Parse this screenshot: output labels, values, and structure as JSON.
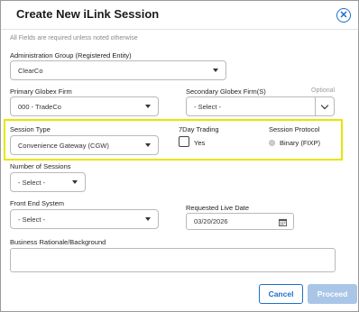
{
  "dialog": {
    "title": "Create New iLink Session",
    "required_note": "All Fields are required unless noted otherwise"
  },
  "fields": {
    "admin_group": {
      "label": "Administration Group (Registered Entity)",
      "value": "ClearCo"
    },
    "primary_firm": {
      "label": "Primary Globex Firm",
      "value": "000 - TradeCo"
    },
    "secondary_firm": {
      "label": "Secondary Globex Firm(S)",
      "optional": "Optional",
      "value": "- Select -"
    },
    "session_type": {
      "label": "Session Type",
      "value": "Convenience Gateway (CGW)"
    },
    "seven_day": {
      "label": "7Day Trading",
      "option": "Yes",
      "checked": false
    },
    "session_protocol": {
      "label": "Session Protocol",
      "option": "Binary (FIXP)"
    },
    "number_of_sessions": {
      "label": "Number of Sessions",
      "value": "- Select -"
    },
    "front_end": {
      "label": "Front End System",
      "value": "- Select -"
    },
    "live_date": {
      "label": "Requested Live Date",
      "value": "03/20/2026"
    },
    "rationale": {
      "label": "Business Rationale/Background",
      "value": ""
    }
  },
  "buttons": {
    "cancel": "Cancel",
    "proceed": "Proceed"
  },
  "icons": {
    "close": "close-circle-icon",
    "calendar": "calendar-icon"
  },
  "colors": {
    "accent": "#1e6ec8",
    "highlight": "#e6e600",
    "proceed_disabled": "#a9c6e8"
  }
}
